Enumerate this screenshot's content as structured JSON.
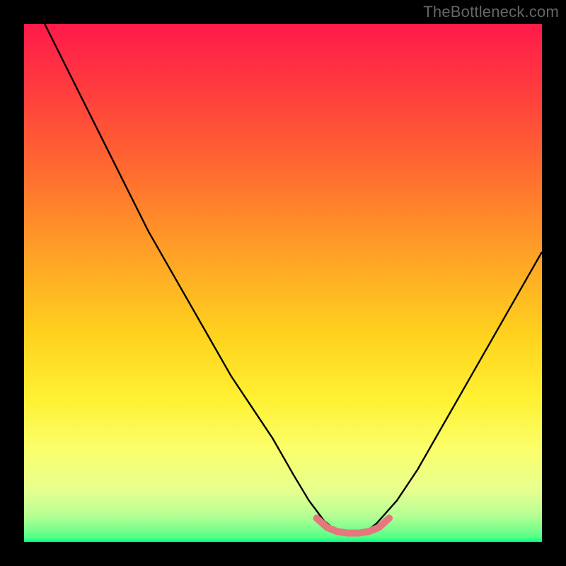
{
  "watermark": "TheBottleneck.com",
  "chart_data": {
    "type": "line",
    "title": "",
    "xlabel": "",
    "ylabel": "",
    "xlim": [
      0,
      100
    ],
    "ylim": [
      0,
      100
    ],
    "gradient_stops": [
      {
        "pct": 0,
        "color": "#ff1a4a"
      },
      {
        "pct": 12,
        "color": "#ff3a3f"
      },
      {
        "pct": 28,
        "color": "#ff6a30"
      },
      {
        "pct": 45,
        "color": "#ffa326"
      },
      {
        "pct": 60,
        "color": "#ffd21e"
      },
      {
        "pct": 72,
        "color": "#fff031"
      },
      {
        "pct": 82,
        "color": "#fbff6a"
      },
      {
        "pct": 90,
        "color": "#e7ff8f"
      },
      {
        "pct": 95,
        "color": "#b4ff94"
      },
      {
        "pct": 99,
        "color": "#59ff88"
      },
      {
        "pct": 100,
        "color": "#00ff83"
      }
    ],
    "series": [
      {
        "name": "bottleneck-curve",
        "color": "#000000",
        "width": 2.4,
        "x": [
          4,
          8,
          12,
          16,
          20,
          24,
          28,
          32,
          36,
          40,
          44,
          48,
          52,
          55,
          58,
          60,
          62,
          64,
          66,
          68,
          72,
          76,
          80,
          84,
          88,
          92,
          96,
          100
        ],
        "y": [
          100,
          92,
          84,
          76,
          68,
          60,
          53,
          46,
          39,
          32,
          26,
          20,
          13,
          8,
          4,
          2.4,
          1.8,
          1.6,
          2.0,
          3.5,
          8,
          14,
          21,
          28,
          35,
          42,
          49,
          56
        ]
      },
      {
        "name": "bottom-highlight",
        "color": "#e4787d",
        "width": 10,
        "linecap": "round",
        "x": [
          56.5,
          58.5,
          60.5,
          62.5,
          64.5,
          66.5,
          68.5,
          70.5
        ],
        "y": [
          4.6,
          2.8,
          2.0,
          1.7,
          1.7,
          2.0,
          2.8,
          4.6
        ]
      }
    ]
  }
}
